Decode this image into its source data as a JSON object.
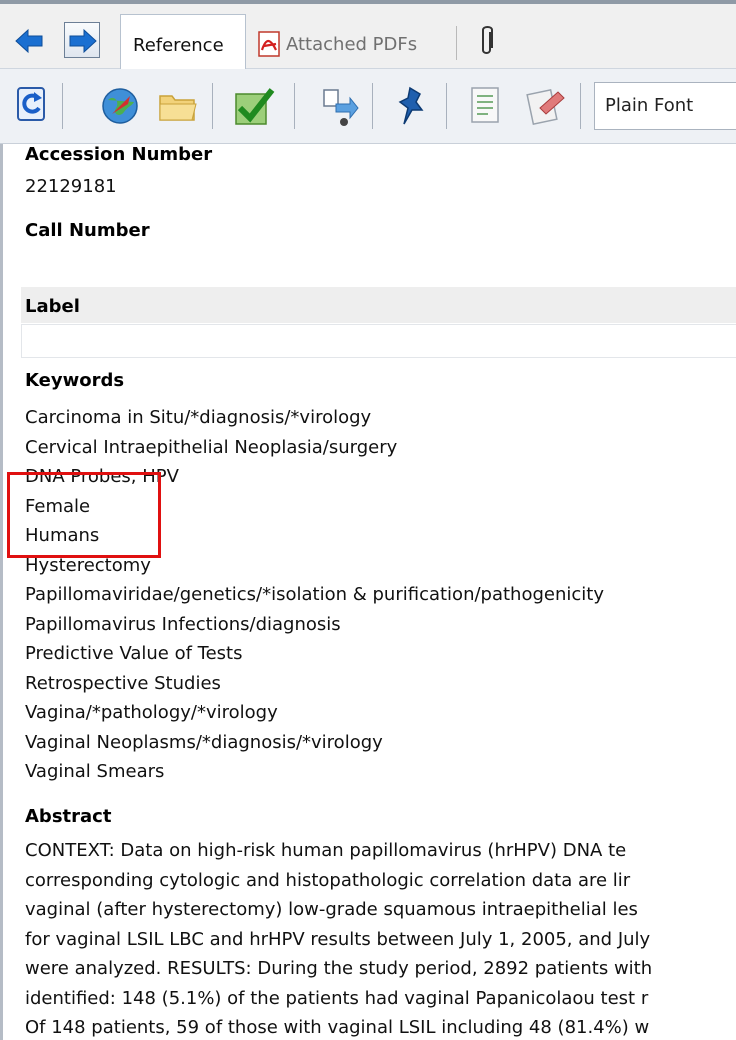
{
  "tabs": {
    "reference": "Reference",
    "attached_pdfs": "Attached PDFs"
  },
  "toolbar": {
    "font_select": "Plain Font"
  },
  "fields": {
    "accession_number": {
      "label": "Accession Number",
      "value": "22129181"
    },
    "call_number": {
      "label": "Call Number",
      "value": ""
    },
    "label": {
      "label": "Label",
      "value": ""
    },
    "keywords": {
      "label": "Keywords",
      "items": [
        "Carcinoma in Situ/*diagnosis/*virology",
        "Cervical Intraepithelial Neoplasia/surgery",
        "DNA Probes, HPV",
        "Female",
        "Humans",
        "Hysterectomy",
        "Papillomaviridae/genetics/*isolation & purification/pathogenicity",
        "Papillomavirus Infections/diagnosis",
        "Predictive Value of Tests",
        "Retrospective Studies",
        "Vagina/*pathology/*virology",
        "Vaginal Neoplasms/*diagnosis/*virology",
        "Vaginal Smears"
      ]
    },
    "abstract": {
      "label": "Abstract",
      "lines": [
        "CONTEXT: Data on high-risk human papillomavirus (hrHPV) DNA te",
        "corresponding cytologic and histopathologic correlation data are lir",
        "vaginal (after hysterectomy) low-grade squamous intraepithelial les",
        "for vaginal LSIL LBC and hrHPV results between July 1, 2005, and July",
        "were analyzed. RESULTS: During the study period, 2892 patients with",
        "identified: 148 (5.1%) of the patients had vaginal Papanicolaou test r",
        "Of 148 patients, 59 of those with vaginal LSIL including 48 (81.4%) w"
      ]
    }
  },
  "icons": [
    "back-arrow-icon",
    "forward-arrow-icon",
    "pdf-icon",
    "paperclip-icon",
    "refresh-icon",
    "globe-icon",
    "folder-icon",
    "checkmark-icon",
    "find-fulltext-icon",
    "pushpin-icon",
    "edit-document-icon",
    "format-icon"
  ],
  "colors": {
    "highlight": "#e01010",
    "accent": "#1a6fd1"
  }
}
